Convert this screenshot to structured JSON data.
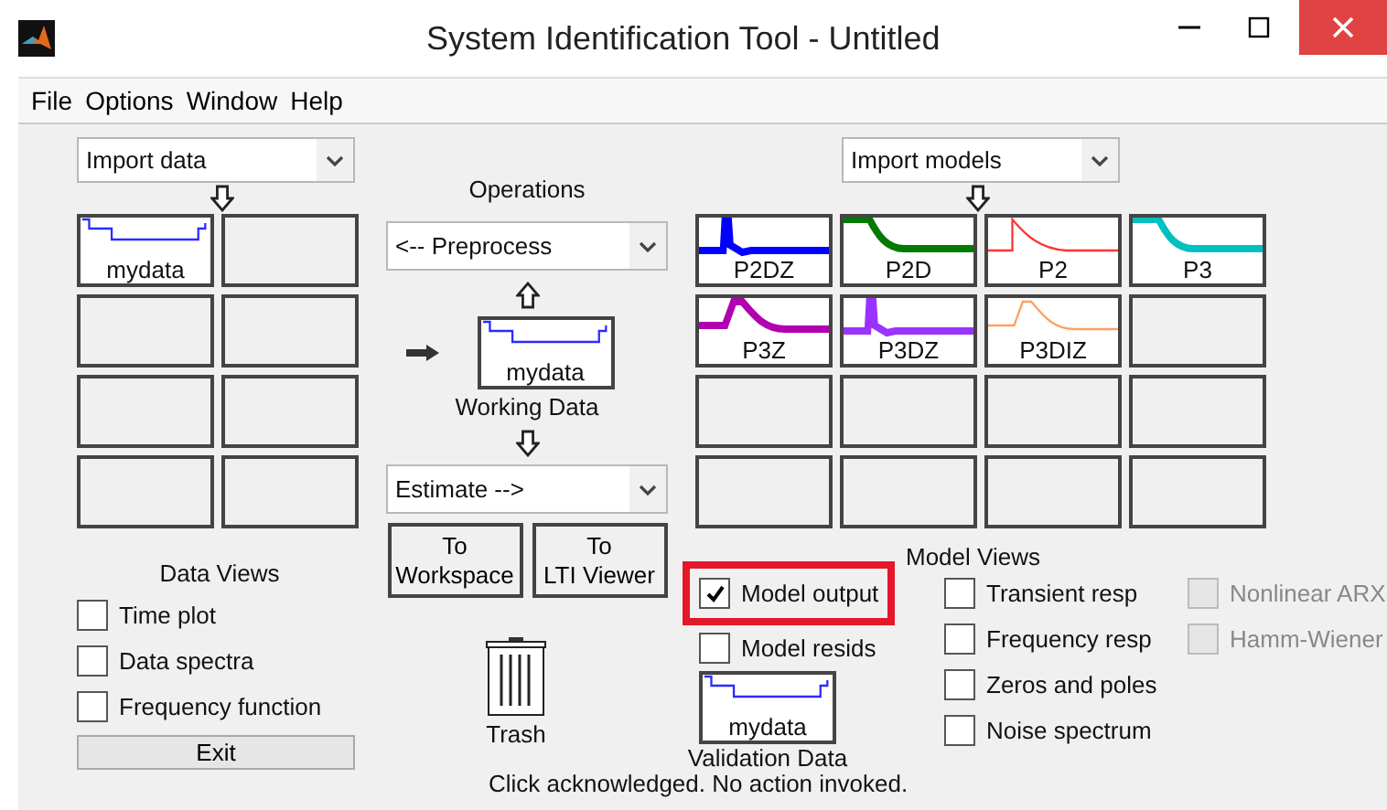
{
  "window": {
    "title": "System Identification Tool - Untitled"
  },
  "menu": [
    "File",
    "Options",
    "Window",
    "Help"
  ],
  "data_import": {
    "value": "Import data"
  },
  "data_slots": [
    {
      "kind": "data",
      "label": "mydata",
      "color": "#2b2bff",
      "thick": false
    },
    {
      "kind": "empty"
    },
    {
      "kind": "empty"
    },
    {
      "kind": "empty"
    },
    {
      "kind": "empty"
    },
    {
      "kind": "empty"
    },
    {
      "kind": "empty"
    },
    {
      "kind": "empty"
    }
  ],
  "operations": {
    "title": "Operations",
    "preprocess": "<-- Preprocess",
    "working_data": {
      "label": "mydata",
      "caption": "Working Data"
    },
    "estimate": "Estimate -->"
  },
  "buttons": [
    {
      "line1": "To",
      "line2": "Workspace"
    },
    {
      "line1": "To",
      "line2": "LTI Viewer"
    }
  ],
  "trash": {
    "label": "Trash"
  },
  "model_import": {
    "value": "Import models"
  },
  "model_slots": [
    {
      "kind": "spike",
      "label": "P2DZ",
      "color": "#0000ff",
      "thick": true
    },
    {
      "kind": "decay",
      "label": "P2D",
      "color": "#007a00",
      "thick": true
    },
    {
      "kind": "pulse",
      "label": "P2",
      "color": "#ff3333",
      "thick": false
    },
    {
      "kind": "decay",
      "label": "P3",
      "color": "#00c0c0",
      "thick": true
    },
    {
      "kind": "bump",
      "label": "P3Z",
      "color": "#b000b0",
      "thick": true
    },
    {
      "kind": "spike",
      "label": "P3DZ",
      "color": "#9933ff",
      "thick": true
    },
    {
      "kind": "bump",
      "label": "P3DIZ",
      "color": "#ffa060",
      "thick": false
    },
    {
      "kind": "empty"
    },
    {
      "kind": "empty"
    },
    {
      "kind": "empty"
    },
    {
      "kind": "empty"
    },
    {
      "kind": "empty"
    },
    {
      "kind": "empty"
    },
    {
      "kind": "empty"
    },
    {
      "kind": "empty"
    },
    {
      "kind": "empty"
    }
  ],
  "data_views": {
    "title": "Data Views",
    "options": [
      {
        "label": "Time plot",
        "checked": false
      },
      {
        "label": "Data spectra",
        "checked": false
      },
      {
        "label": "Frequency function",
        "checked": false
      }
    ],
    "exit": "Exit"
  },
  "model_views": {
    "title": "Model Views",
    "column_1": [
      {
        "label": "Model output",
        "checked": true,
        "highlighted": true
      },
      {
        "label": "Model resids",
        "checked": false,
        "highlighted": false
      }
    ],
    "validation_data": {
      "label": "mydata",
      "caption": "Validation Data"
    },
    "column_2": [
      {
        "label": "Transient resp",
        "checked": false,
        "disabled": false
      },
      {
        "label": "Frequency resp",
        "checked": false,
        "disabled": false
      },
      {
        "label": "Zeros and poles",
        "checked": false,
        "disabled": false
      },
      {
        "label": "Noise spectrum",
        "checked": false,
        "disabled": false
      }
    ],
    "column_3": [
      {
        "label": "Nonlinear ARX",
        "checked": false,
        "disabled": true
      },
      {
        "label": "Hamm-Wiener",
        "checked": false,
        "disabled": true
      }
    ]
  },
  "status_bar": "Click acknowledged. No action invoked."
}
